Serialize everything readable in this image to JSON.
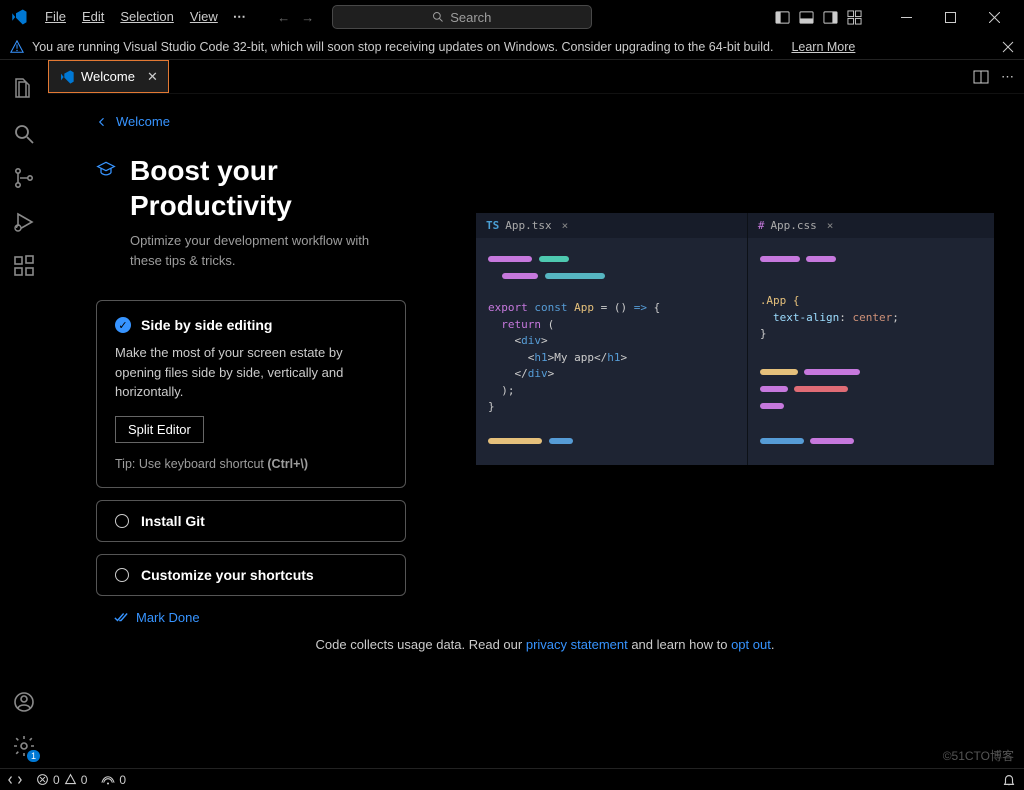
{
  "menu": {
    "file": "File",
    "edit": "Edit",
    "selection": "Selection",
    "view": "View"
  },
  "search": {
    "placeholder": "Search"
  },
  "notification": {
    "text": "You are running Visual Studio Code 32-bit, which will soon stop receiving updates on Windows. Consider upgrading to the 64-bit build.",
    "learn_more": "Learn More"
  },
  "tab": {
    "title": "Welcome"
  },
  "breadcrumb": {
    "label": "Welcome"
  },
  "heading": {
    "line1": "Boost your",
    "line2": "Productivity"
  },
  "subtitle": "Optimize your development workflow with these tips & tricks.",
  "card1": {
    "title": "Side by side editing",
    "body": "Make the most of your screen estate by opening files side by side, vertically and horizontally.",
    "button": "Split Editor",
    "tip_prefix": "Tip: Use keyboard shortcut ",
    "tip_shortcut": "(Ctrl+\\)"
  },
  "card2": {
    "title": "Install Git"
  },
  "card3": {
    "title": "Customize your shortcuts"
  },
  "mark_done": "Mark Done",
  "preview": {
    "tab1": "App.tsx",
    "tab2": "App.css",
    "tsx": {
      "l1a": "export ",
      "l1b": "const ",
      "l1c": "App",
      "l1d": " = () ",
      "l1e": "=>",
      "l1f": " {",
      "l2a": "  return ",
      "l2b": "(",
      "l3a": "    <",
      "l3b": "div",
      "l3c": ">",
      "l4a": "      <",
      "l4b": "h1",
      "l4c": ">",
      "l4d": "My app",
      "l4e": "</",
      "l4f": "h1",
      "l4g": ">",
      "l5a": "    </",
      "l5b": "div",
      "l5c": ">",
      "l6": "  );",
      "l7": "}"
    },
    "css": {
      "l1": ".App {",
      "l2a": "  text-align",
      "l2b": ": ",
      "l2c": "center",
      "l2d": ";",
      "l3": "}"
    }
  },
  "privacy": {
    "pre": "Code collects usage data. Read our ",
    "link1": "privacy statement",
    "mid": " and learn how to ",
    "link2": "opt out",
    "post": "."
  },
  "statusbar": {
    "errors": "0",
    "warnings": "0",
    "ports": "0",
    "settings_badge": "1"
  },
  "watermark": "©51CTO博客"
}
